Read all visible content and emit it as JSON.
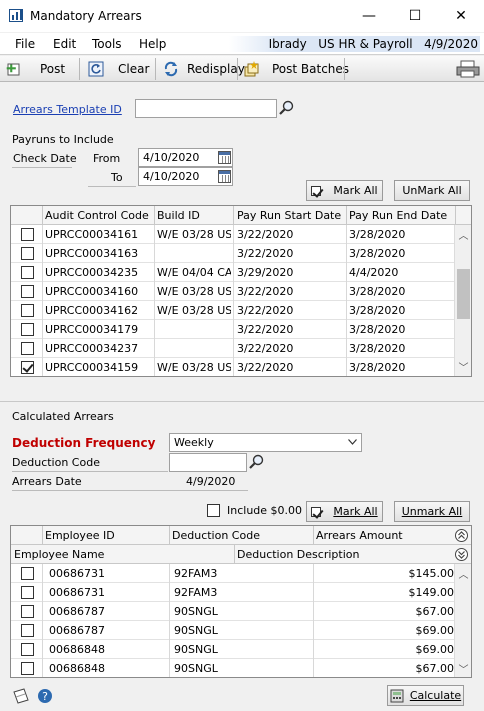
{
  "window": {
    "title": "Mandatory Arrears",
    "minimize": "—",
    "maximize": "☐",
    "close": "✕"
  },
  "menu": {
    "items": [
      "File",
      "Edit",
      "Tools",
      "Help"
    ],
    "user": "Ibrady",
    "company": "US HR & Payroll",
    "date": "4/9/2020"
  },
  "toolbar": {
    "post": "Post",
    "clear": "Clear",
    "redisplay": "Redisplay",
    "post_batches": "Post Batches"
  },
  "template": {
    "label": "Arrears Template ID",
    "value": ""
  },
  "payruns": {
    "section_label": "Payruns to Include",
    "check_date_label": "Check Date",
    "from_label": "From",
    "from_value": "4/10/2020",
    "to_label": "To",
    "to_value": "4/10/2020",
    "mark_all": "Mark All",
    "unmark_all": "UnMark All",
    "columns": [
      "Audit Control Code",
      "Build ID",
      "Pay Run Start Date",
      "Pay Run End Date"
    ],
    "rows": [
      {
        "checked": false,
        "code": "UPRCC00034161",
        "build": "W/E 03/28  US",
        "start": "3/22/2020",
        "end": "3/28/2020"
      },
      {
        "checked": false,
        "code": "UPRCC00034163",
        "build": "",
        "start": "3/22/2020",
        "end": "3/28/2020"
      },
      {
        "checked": false,
        "code": "UPRCC00034235",
        "build": "W/E 04/04  CA",
        "start": "3/29/2020",
        "end": "4/4/2020"
      },
      {
        "checked": false,
        "code": "UPRCC00034160",
        "build": "W/E 03/28  US",
        "start": "3/22/2020",
        "end": "3/28/2020"
      },
      {
        "checked": false,
        "code": "UPRCC00034162",
        "build": "W/E 03/28  US",
        "start": "3/22/2020",
        "end": "3/28/2020"
      },
      {
        "checked": false,
        "code": "UPRCC00034179",
        "build": "",
        "start": "3/22/2020",
        "end": "3/28/2020"
      },
      {
        "checked": false,
        "code": "UPRCC00034237",
        "build": "",
        "start": "3/22/2020",
        "end": "3/28/2020"
      },
      {
        "checked": true,
        "code": "UPRCC00034159",
        "build": "W/E 03/28  US",
        "start": "3/22/2020",
        "end": "3/28/2020"
      }
    ]
  },
  "calculated": {
    "section_label": "Calculated Arrears",
    "freq_label": "Deduction Frequency",
    "freq_value": "Weekly",
    "code_label": "Deduction Code",
    "code_value": "",
    "date_label": "Arrears Date",
    "date_value": "4/9/2020",
    "include_zero": "Include $0.00",
    "mark_all": "Mark All",
    "unmark_all": "Unmark All",
    "columns": [
      "Employee ID",
      "Deduction Code",
      "Arrears Amount"
    ],
    "columns2": [
      "Employee Name",
      "Deduction Description"
    ],
    "rows": [
      {
        "checked": false,
        "emp": "00686731",
        "code": "92FAM3",
        "amount": "$145.00"
      },
      {
        "checked": false,
        "emp": "00686731",
        "code": "92FAM3",
        "amount": "$149.00"
      },
      {
        "checked": false,
        "emp": "00686787",
        "code": "90SNGL",
        "amount": "$67.00"
      },
      {
        "checked": false,
        "emp": "00686787",
        "code": "90SNGL",
        "amount": "$69.00"
      },
      {
        "checked": false,
        "emp": "00686848",
        "code": "90SNGL",
        "amount": "$69.00"
      },
      {
        "checked": false,
        "emp": "00686848",
        "code": "90SNGL",
        "amount": "$67.00"
      }
    ],
    "calculate": "Calculate"
  }
}
